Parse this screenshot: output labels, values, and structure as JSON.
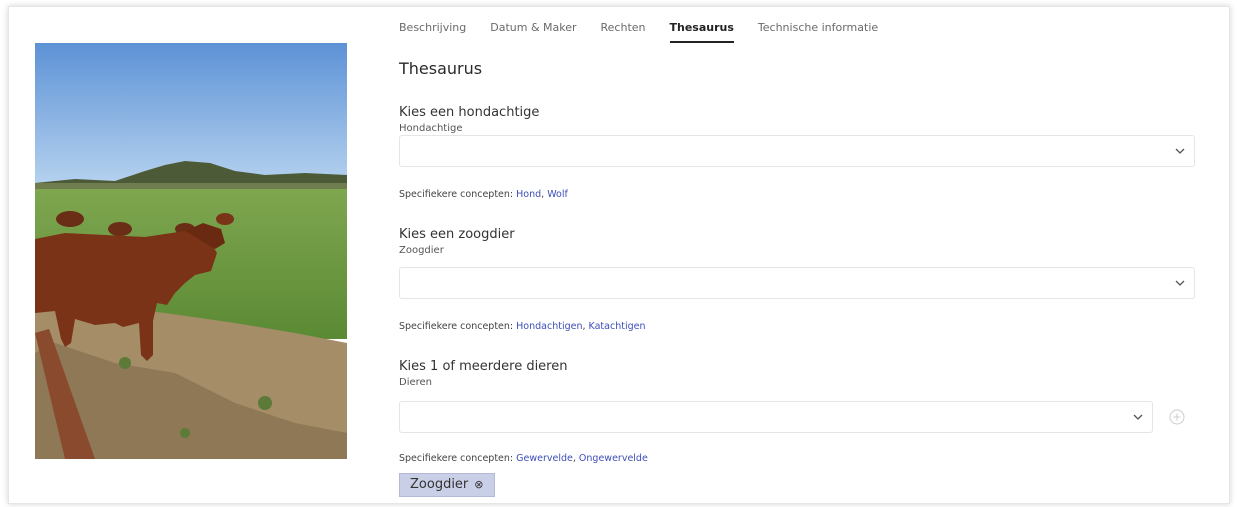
{
  "tabs": [
    {
      "label": "Beschrijving",
      "active": false
    },
    {
      "label": "Datum & Maker",
      "active": false
    },
    {
      "label": "Rechten",
      "active": false
    },
    {
      "label": "Thesaurus",
      "active": true
    },
    {
      "label": "Technische informatie",
      "active": false
    }
  ],
  "section_title": "Thesaurus",
  "fields": [
    {
      "label": "Kies een hondachtige",
      "sublabel": "Hondachtige",
      "value": "",
      "specific_prefix": "Specifiekere concepten:",
      "links": [
        "Hond",
        "Wolf"
      ]
    },
    {
      "label": "Kies een zoogdier",
      "sublabel": "Zoogdier",
      "value": "",
      "specific_prefix": "Specifiekere concepten:",
      "links": [
        "Hondachtigen",
        "Katachtigen"
      ]
    },
    {
      "label": "Kies 1 of meerdere dieren",
      "sublabel": "Dieren",
      "value": "",
      "specific_prefix": "Specifiekere concepten:",
      "links": [
        "Gewervelde",
        "Ongewervelde"
      ]
    }
  ],
  "selected_chip": {
    "label": "Zoogdier",
    "remove_symbol": "⊗"
  },
  "colors": {
    "link": "#3d4eb8",
    "chip_bg": "#c9cfe7"
  },
  "icons": {
    "select": "chevron-down-icon",
    "add": "add-circle-icon",
    "remove": "remove-circle-icon"
  }
}
